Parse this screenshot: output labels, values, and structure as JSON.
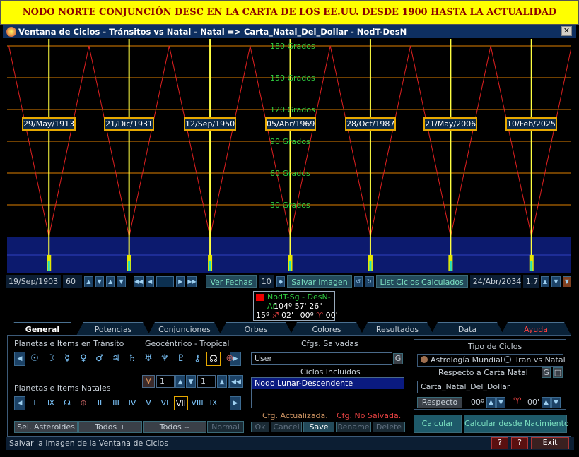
{
  "banner": "NODO NORTE CONJUNCIÓN DESC EN LA CARTA DE LOS EE.UU. DESDE 1900 HASTA LA ACTUALIDAD",
  "window": {
    "title": "Ventana de Ciclos - Tránsitos vs Natal - Natal => Carta_Natal_Del_Dollar - NodT-DesN",
    "close": "✕"
  },
  "chart_data": {
    "type": "line",
    "ylim": [
      0,
      180
    ],
    "yticks": [
      {
        "value": 180,
        "label": "180 Grados"
      },
      {
        "value": 150,
        "label": "150 Grados"
      },
      {
        "value": 120,
        "label": "120 Grados"
      },
      {
        "value": 90,
        "label": "90 Grados"
      },
      {
        "value": 60,
        "label": "60 Grados"
      },
      {
        "value": 30,
        "label": "30 Grados"
      }
    ],
    "x_start": "19/Sep/1903",
    "x_end": "24/Abr/2034",
    "conjunctions": [
      "29/May/1913",
      "21/Dic/1931",
      "12/Sep/1950",
      "05/Abr/1969",
      "28/Oct/1987",
      "21/May/2006",
      "10/Feb/2025"
    ],
    "colors": {
      "zigzag": "#e02020",
      "conjunction_line": "#ffff40",
      "gridline": "#e08000",
      "grid_label": "#2ecc40",
      "band": "#0c1a6e"
    }
  },
  "controls": {
    "start_date": "19/Sep/1903",
    "step_value": "60",
    "ver_fechas": "Ver Fechas",
    "fechas_count": "10",
    "salvar_imagen": "Salvar Imagen",
    "list_ciclos": "List Ciclos Calculados",
    "end_date": "24/Abr/2034",
    "zoom_value": "1.7"
  },
  "info": {
    "line1": "NodT-Sg - DesN-Ar",
    "line2": "104º 57' 26\"",
    "line3_a": "15º",
    "line3_b": "02'",
    "line3_c": "00º",
    "line3_d": "00'"
  },
  "tabs": [
    "General",
    "Potencias",
    "Conjunciones",
    "Orbes",
    "Colores",
    "Resultados",
    "Data",
    "Ayuda"
  ],
  "panel": {
    "transit_label": "Planetas e Items en Tránsito",
    "geo_label": "Geocéntrico - Tropical",
    "transit_glyphs": [
      "☉",
      "☽",
      "☿",
      "♀",
      "♂",
      "♃",
      "♄",
      "♅",
      "♆",
      "♇",
      "⚷",
      "☊",
      "⊕"
    ],
    "natal_label": "Planetas e Items Natales",
    "natal_v": "V",
    "natal_val1": "1",
    "natal_val2": "1",
    "natal_glyphs": [
      "I",
      "Ⅸ",
      "☊",
      "⊕",
      "II",
      "III",
      "IV",
      "V",
      "VI",
      "VII",
      "VIII",
      "IX"
    ],
    "sel_asteroides": "Sel. Asteroides",
    "todos_plus": "Todos +",
    "todos_minus": "Todos --",
    "normal": "Normal",
    "cfgs_salvadas": "Cfgs. Salvadas",
    "cfg_value": "User",
    "g_btn": "G",
    "ciclos_incluidos": "Ciclos Incluidos",
    "ciclo_item": "Nodo Lunar-Descendente",
    "cfg_actualizada": "Cfg. Actualizada.",
    "cfg_no_salvada": "Cfg. No Salvada.",
    "ok": "Ok",
    "cancel": "Cancel",
    "save": "Save",
    "rename": "Rename",
    "delete": "Delete",
    "tipo_ciclos": "Tipo de Ciclos",
    "astro_mundial": "Astrología Mundial",
    "tran_vs_natal": "Tran vs Natal",
    "respecto_carta": "Respecto a Carta Natal",
    "carta_name": "Carta_Natal_Del_Dollar",
    "respecto_btn": "Respecto",
    "deg_value": "00º",
    "min_value": "00'",
    "calcular": "Calcular",
    "calcular_nac": "Calcular desde Nacimiento"
  },
  "status": {
    "text": "Salvar la Imagen de la Ventana de Ciclos",
    "exit": "Exit"
  }
}
